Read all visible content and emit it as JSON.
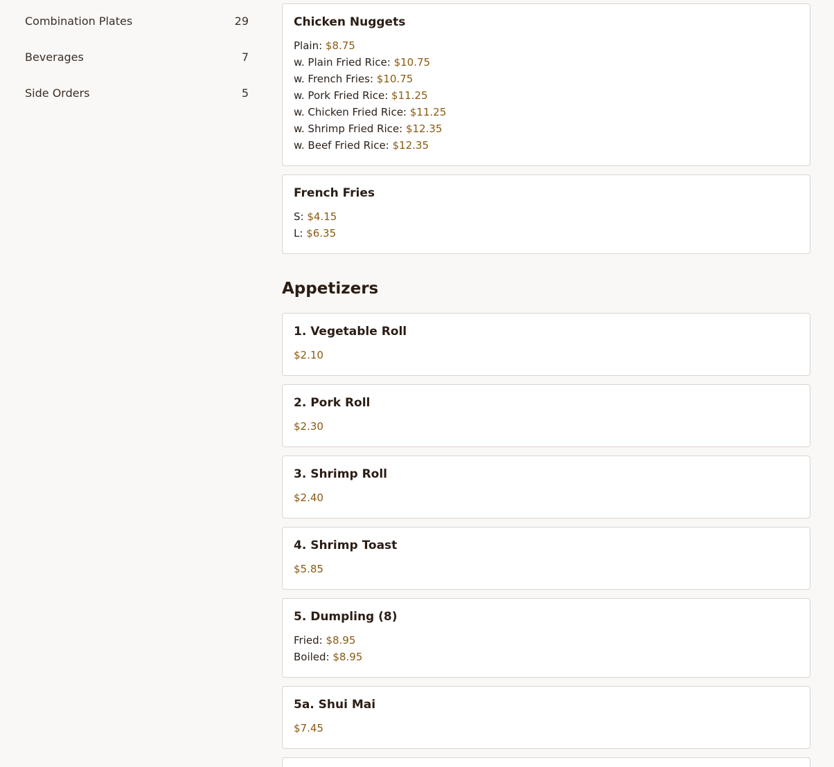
{
  "sidebar": {
    "categories": [
      {
        "name": "Combination Plates",
        "count": "29"
      },
      {
        "name": "Beverages",
        "count": "7"
      },
      {
        "name": "Side Orders",
        "count": "5"
      }
    ]
  },
  "menu": {
    "items_top": [
      {
        "title": "Chicken Nuggets",
        "options": [
          {
            "label": "Plain: ",
            "price": "$8.75"
          },
          {
            "label": "w. Plain Fried Rice: ",
            "price": "$10.75"
          },
          {
            "label": "w. French Fries: ",
            "price": "$10.75"
          },
          {
            "label": "w. Pork Fried Rice: ",
            "price": "$11.25"
          },
          {
            "label": "w. Chicken Fried Rice: ",
            "price": "$11.25"
          },
          {
            "label": "w. Shrimp Fried Rice: ",
            "price": "$12.35"
          },
          {
            "label": "w. Beef Fried Rice: ",
            "price": "$12.35"
          }
        ]
      },
      {
        "title": "French Fries",
        "options": [
          {
            "label": "S: ",
            "price": "$4.15"
          },
          {
            "label": "L: ",
            "price": "$6.35"
          }
        ]
      }
    ],
    "appetizers_title": "Appetizers",
    "appetizers": [
      {
        "title": "1. Vegetable Roll",
        "options": [
          {
            "label": "",
            "price": "$2.10"
          }
        ]
      },
      {
        "title": "2. Pork Roll",
        "options": [
          {
            "label": "",
            "price": "$2.30"
          }
        ]
      },
      {
        "title": "3. Shrimp Roll",
        "options": [
          {
            "label": "",
            "price": "$2.40"
          }
        ]
      },
      {
        "title": "4. Shrimp Toast",
        "options": [
          {
            "label": "",
            "price": "$5.85"
          }
        ]
      },
      {
        "title": "5. Dumpling (8)",
        "options": [
          {
            "label": "Fried: ",
            "price": "$8.95"
          },
          {
            "label": "Boiled: ",
            "price": "$8.95"
          }
        ]
      },
      {
        "title": "5a. Shui Mai",
        "options": [
          {
            "label": "",
            "price": "$7.45"
          }
        ]
      }
    ]
  }
}
